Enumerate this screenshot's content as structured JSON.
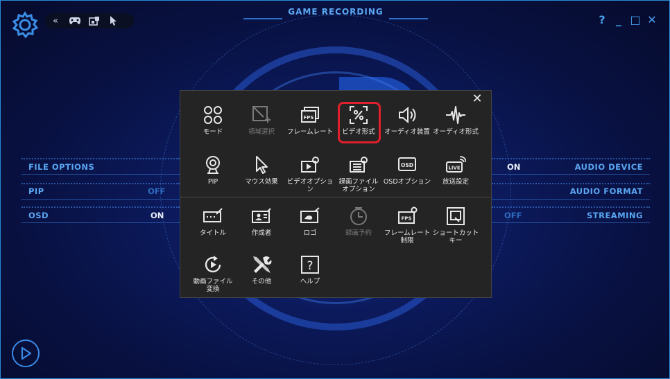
{
  "window": {
    "title": "GAME RECORDING",
    "help_label": "?",
    "minimize_label": "_",
    "maximize_label": "□",
    "close_label": "✕"
  },
  "toolbar": {
    "icons": [
      "collapse-icon",
      "gamepad-icon",
      "window-lock-icon",
      "cursor-icon"
    ],
    "collapse_glyph": "«"
  },
  "left_options": [
    {
      "label": "FILE OPTIONS",
      "value": ""
    },
    {
      "label": "PIP",
      "value": "OFF"
    },
    {
      "label": "OSD",
      "value": "ON"
    }
  ],
  "right_options": [
    {
      "label": "AUDIO DEVICE",
      "value": "ON"
    },
    {
      "label": "AUDIO FORMAT",
      "value": ""
    },
    {
      "label": "STREAMING",
      "value": "OFF"
    }
  ],
  "panel": {
    "close_label": "✕",
    "rows": [
      [
        {
          "label": "モード",
          "icon": "mode-icon",
          "enabled": true
        },
        {
          "label": "領域選択",
          "icon": "region-select-icon",
          "enabled": false
        },
        {
          "label": "フレームレート",
          "icon": "fps-icon",
          "enabled": true
        },
        {
          "label": "ビデオ形式",
          "icon": "video-format-icon",
          "enabled": true,
          "highlighted": true
        },
        {
          "label": "オーディオ装置",
          "icon": "speaker-icon",
          "enabled": true
        },
        {
          "label": "オーディオ形式",
          "icon": "waveform-icon",
          "enabled": true
        }
      ],
      [
        {
          "label": "PIP",
          "icon": "webcam-icon",
          "enabled": true
        },
        {
          "label": "マウス効果",
          "icon": "cursor-icon",
          "enabled": true
        },
        {
          "label": "ビデオオプション",
          "icon": "video-settings-icon",
          "enabled": true
        },
        {
          "label": "録画ファイル\nオプション",
          "icon": "file-settings-icon",
          "enabled": true
        },
        {
          "label": "OSDオプション",
          "icon": "osd-icon",
          "enabled": true
        },
        {
          "label": "放送設定",
          "icon": "live-icon",
          "enabled": true
        }
      ],
      [
        {
          "label": "タイトル",
          "icon": "title-icon",
          "enabled": true
        },
        {
          "label": "作成者",
          "icon": "author-icon",
          "enabled": true
        },
        {
          "label": "ロゴ",
          "icon": "logo-icon",
          "enabled": true
        },
        {
          "label": "録画予約",
          "icon": "clock-icon",
          "enabled": false
        },
        {
          "label": "フレームレート\n制限",
          "icon": "fps-limit-icon",
          "enabled": true
        },
        {
          "label": "ショートカット\nキー",
          "icon": "shortcut-icon",
          "enabled": true
        }
      ],
      [
        {
          "label": "動画ファイル\n変換",
          "icon": "convert-icon",
          "enabled": true
        },
        {
          "label": "その他",
          "icon": "tools-icon",
          "enabled": true
        },
        {
          "label": "ヘルプ",
          "icon": "help-icon",
          "enabled": true
        }
      ]
    ]
  },
  "colors": {
    "accent": "#5aa6f2",
    "panel_bg": "#242424",
    "highlight": "#e0202c"
  }
}
